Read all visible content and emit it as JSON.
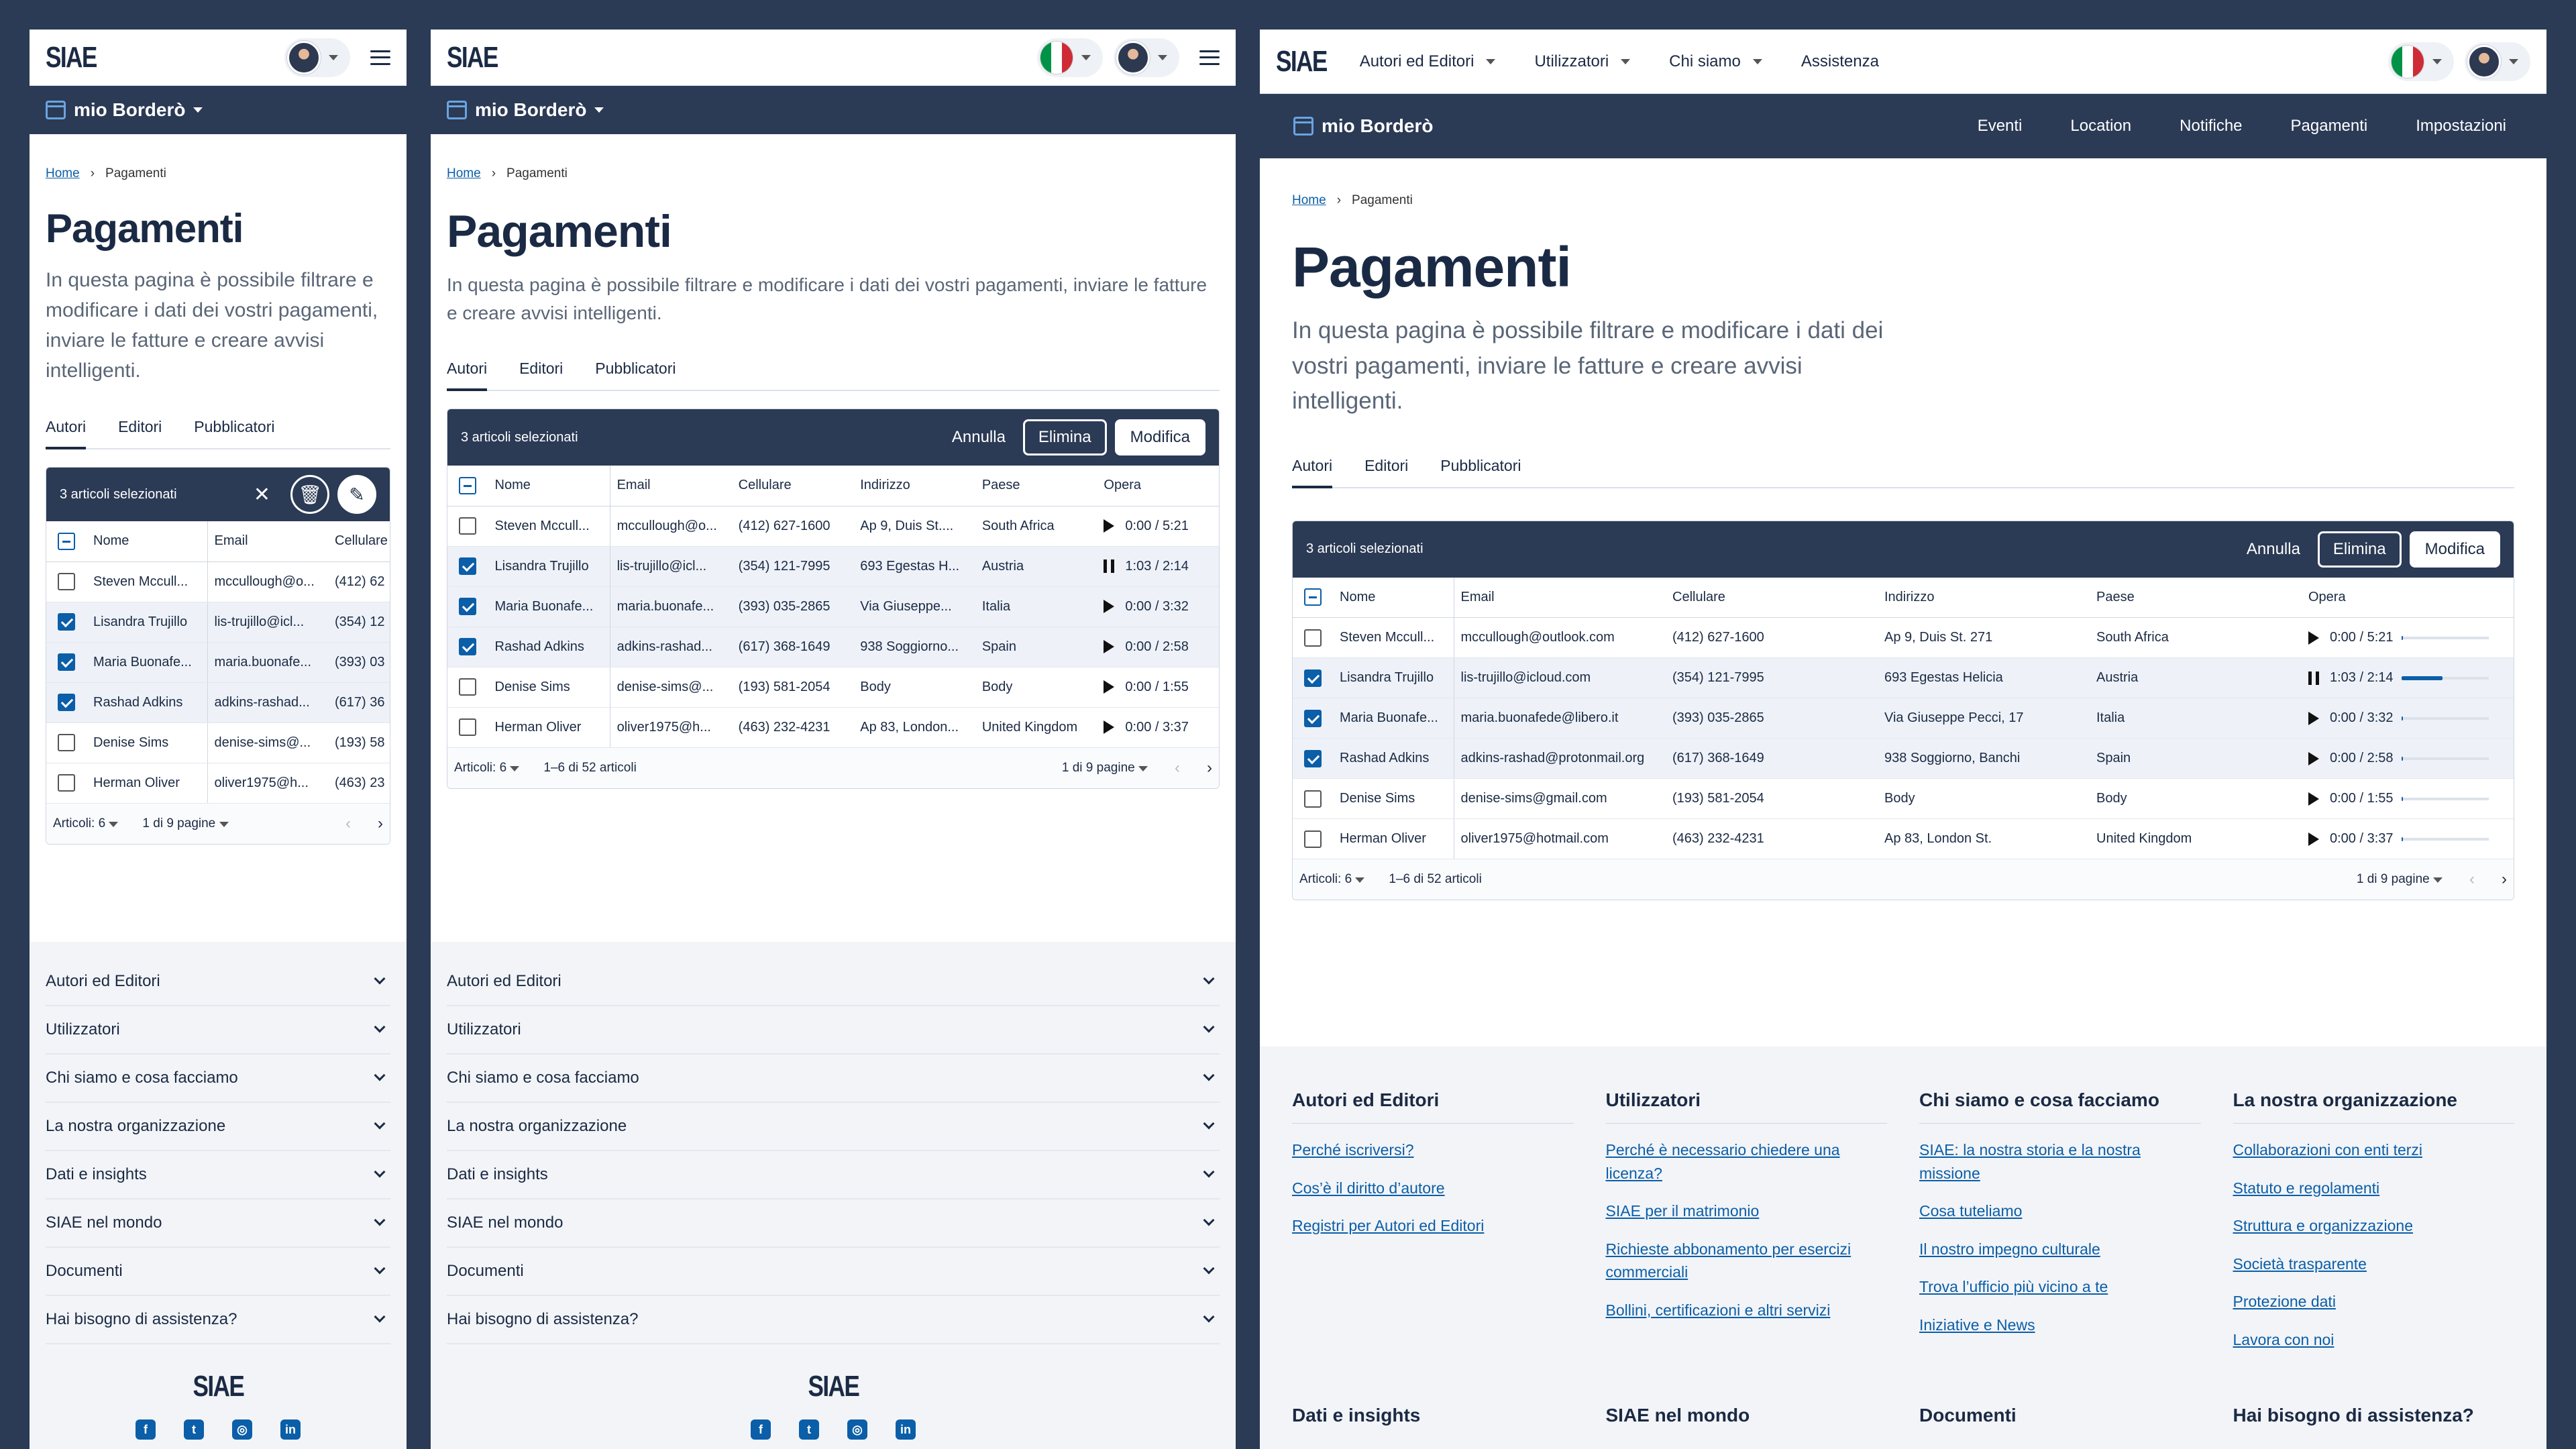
{
  "brand": {
    "logo": "SIAE",
    "app_name": "mio Borderò"
  },
  "colors": {
    "navy": "#2b3a55",
    "link": "#0b5ea8",
    "flag_green": "#009246",
    "flag_red": "#ce2b37"
  },
  "nav": {
    "top": [
      "Autori ed Editori",
      "Utilizzatori",
      "Chi siamo",
      "Assistenza"
    ],
    "sub": [
      "Eventi",
      "Location",
      "Notifiche",
      "Pagamenti",
      "Impostazioni"
    ]
  },
  "breadcrumb": {
    "home": "Home",
    "current": "Pagamenti"
  },
  "page": {
    "title": "Pagamenti",
    "lede": "In questa pagina è possibile filtrare e modificare i dati dei vostri pagamenti, inviare le fatture e creare avvisi intelligenti."
  },
  "tabs": [
    "Autori",
    "Editori",
    "Pubblicatori"
  ],
  "selection": {
    "count_text": "3 articoli selezionati",
    "cancel": "Annulla",
    "delete": "Elimina",
    "edit": "Modifica"
  },
  "table": {
    "headers": [
      "Nome",
      "Email",
      "Cellulare",
      "Indirizzo",
      "Paese",
      "Opera"
    ],
    "rows": [
      {
        "name": "Steven Mccull...",
        "email": "mccullough@outlook.com",
        "phone": "(412) 627-1600",
        "address": "Ap 9, Duis St. 271",
        "country": "South Africa",
        "time": "0:00 / 5:21",
        "checked": false,
        "playing": false,
        "progress": 0.02
      },
      {
        "name": "Lisandra Trujillo",
        "email": "lis-trujillo@icloud.com",
        "phone": "(354) 121-7995",
        "address": "693 Egestas Helicia",
        "country": "Austria",
        "time": "1:03 / 2:14",
        "checked": true,
        "playing": true,
        "progress": 0.47
      },
      {
        "name": "Maria Buonafe...",
        "email": "maria.buonafede@libero.it",
        "phone": "(393) 035-2865",
        "address": "Via Giuseppe Pecci, 17",
        "country": "Italia",
        "time": "0:00 / 3:32",
        "checked": true,
        "playing": false,
        "progress": 0.02
      },
      {
        "name": "Rashad Adkins",
        "email": "adkins-rashad@protonmail.org",
        "phone": "(617) 368-1649",
        "address": "938 Soggiorno, Banchi",
        "country": "Spain",
        "time": "0:00 / 2:58",
        "checked": true,
        "playing": false,
        "progress": 0.02
      },
      {
        "name": "Denise Sims",
        "email": "denise-sims@gmail.com",
        "phone": "(193) 581-2054",
        "address": "Body",
        "country": "Body",
        "time": "0:00 / 1:55",
        "checked": false,
        "playing": false,
        "progress": 0.02
      },
      {
        "name": "Herman Oliver",
        "email": "oliver1975@hotmail.com",
        "phone": "(463) 232-4231",
        "address": "Ap 83, London St.",
        "country": "United Kingdom",
        "time": "0:00 / 3:37",
        "checked": false,
        "playing": false,
        "progress": 0.02
      }
    ],
    "short_rows": [
      {
        "email": "mccullough@o...",
        "phone": "(412) 62",
        "address": "Ap 9, Duis St...."
      },
      {
        "email": "lis-trujillo@icl...",
        "phone": "(354) 12",
        "address": "693 Egestas H..."
      },
      {
        "email": "maria.buonafe...",
        "phone": "(393) 03",
        "address": "Via Giuseppe..."
      },
      {
        "email": "adkins-rashad...",
        "phone": "(617) 36",
        "address": "938 Soggiorno..."
      },
      {
        "email": "denise-sims@...",
        "phone": "(193) 58",
        "address": "Body"
      },
      {
        "email": "oliver1975@h...",
        "phone": "(463) 23",
        "address": "Ap 83, London..."
      }
    ]
  },
  "pager": {
    "per_page": "Articoli: 6",
    "range": "1–6 di 52 articoli",
    "pages": "1 di 9 pagine"
  },
  "footer": {
    "accordion": [
      "Autori ed Editori",
      "Utilizzatori",
      "Chi siamo e cosa facciamo",
      "La nostra organizzazione",
      "Dati e insights",
      "SIAE nel mondo",
      "Documenti",
      "Hai bisogno di assistenza?"
    ],
    "columns": [
      {
        "title": "Autori ed Editori",
        "links": [
          "Perché iscriversi?",
          "Cos’è il diritto d’autore",
          "Registri per Autori ed Editori"
        ]
      },
      {
        "title": "Utilizzatori",
        "links": [
          "Perché è necessario chiedere una licenza?",
          "SIAE per il matrimonio",
          "Richieste abbonamento per esercizi commerciali",
          "Bollini, certificazioni e altri servizi"
        ]
      },
      {
        "title": "Chi siamo e cosa facciamo",
        "links": [
          "SIAE: la nostra storia e la nostra missione",
          "Cosa tuteliamo",
          "Il nostro impegno culturale",
          "Trova l’ufficio più vicino a te",
          "Iniziative e News"
        ]
      },
      {
        "title": "La nostra organizzazione",
        "links": [
          "Collaborazioni con enti terzi",
          "Statuto e regolamenti",
          "Struttura e organizzazione",
          "Società trasparente",
          "Protezione dati",
          "Lavora con noi"
        ]
      }
    ],
    "second_row": [
      "Dati e insights",
      "SIAE nel mondo",
      "Documenti",
      "Hai bisogno di assistenza?"
    ],
    "social": [
      "facebook-icon",
      "twitter-icon",
      "instagram-icon",
      "linkedin-icon"
    ]
  }
}
